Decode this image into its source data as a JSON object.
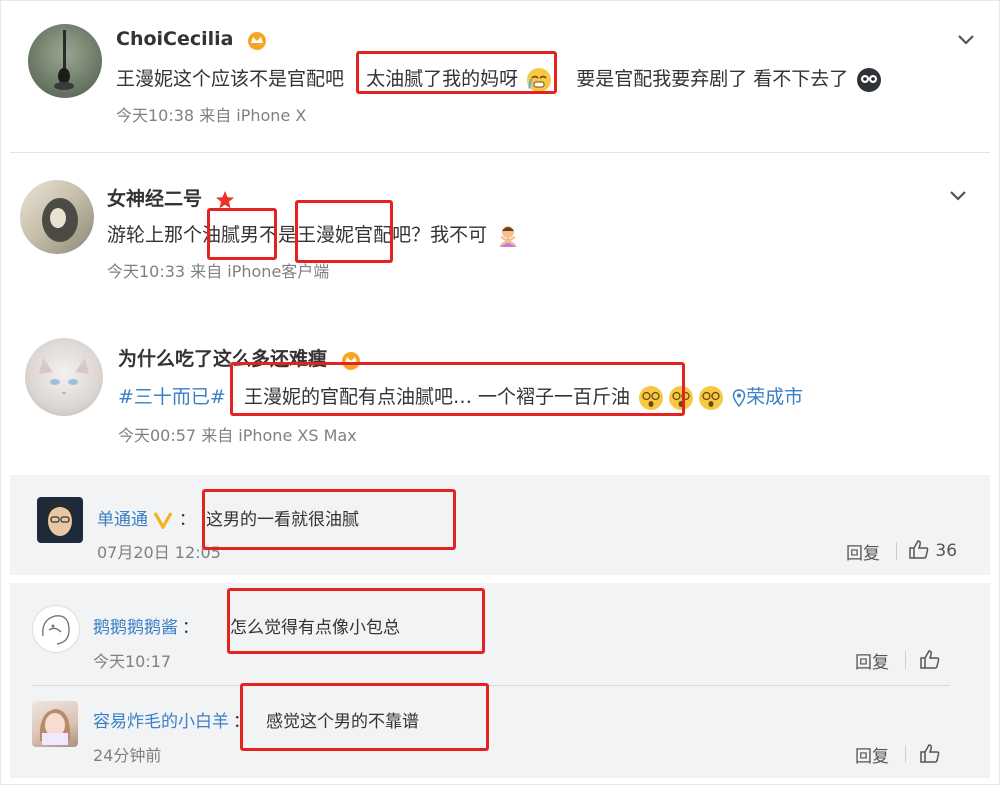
{
  "comments": [
    {
      "user": "ChoiCecilia",
      "text_a": "王漫妮这个应该不是官配吧",
      "text_b": "太油腻了我的妈呀",
      "text_c": "要是官配我要弃剧了 看不下去了",
      "meta": "今天10:38  来自 iPhone X"
    },
    {
      "user": "女神经二号",
      "text_a": "游轮上那个",
      "text_b": "油腻男",
      "text_c": "不是",
      "text_d": "王漫妮官",
      "text_e": "配吧？我不可",
      "meta": "今天10:33  来自 iPhone客户端"
    },
    {
      "user": "为什么吃了这么多还难瘦",
      "topic": "#三十而已#",
      "text_a": "王漫妮的官配有点油腻吧… 一个褶子一百斤油",
      "location": "荣成市",
      "meta": "今天00:57  来自 iPhone XS Max"
    }
  ],
  "replies": [
    {
      "user": "单通通",
      "sep": "：",
      "text": "这男的一看就很油腻",
      "time": "07月20日 12:05",
      "reply_label": "回复",
      "likes": "36"
    },
    {
      "user": "鹅鹅鹅鹅酱",
      "sep": "：",
      "text": "怎么觉得有点像小包总",
      "time": "今天10:17",
      "reply_label": "回复"
    },
    {
      "user": "容易炸毛的小白羊",
      "sep": "：",
      "text": "感觉这个男的不靠谱",
      "time": "24分钟前",
      "reply_label": "回复"
    }
  ],
  "colors": {
    "highlight": "#e52222",
    "link": "#3b7fc4",
    "reply_bg": "#f2f3f5"
  }
}
